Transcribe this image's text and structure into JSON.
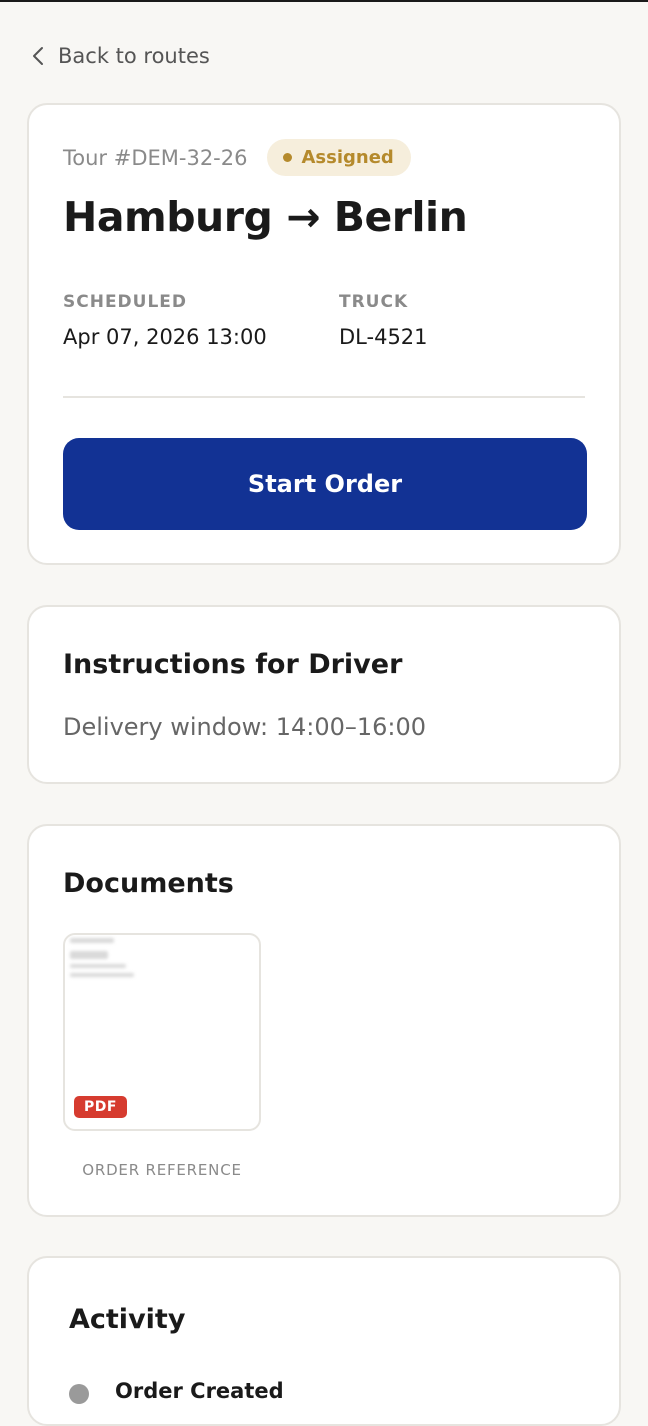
{
  "nav": {
    "back_label": "Back to routes",
    "back_icon": "chevron-left-icon"
  },
  "tour": {
    "id_label": "Tour #DEM-32-26",
    "status": "Assigned",
    "route": "Hamburg → Berlin",
    "scheduled_label": "SCHEDULED",
    "scheduled_value": "Apr 07, 2026 13:00",
    "truck_label": "TRUCK",
    "truck_value": "DL-4521",
    "start_button_label": "Start Order"
  },
  "instructions": {
    "title": "Instructions for Driver",
    "text": "Delivery window: 14:00–16:00"
  },
  "documents": {
    "title": "Documents",
    "items": [
      {
        "type_badge": "PDF",
        "caption": "ORDER REFERENCE"
      }
    ]
  },
  "activity": {
    "title": "Activity",
    "items": [
      {
        "label": "Order Created"
      }
    ]
  },
  "colors": {
    "background": "#f8f7f4",
    "card": "#ffffff",
    "primary": "#123294",
    "badge_bg": "#f6eedc",
    "badge_text": "#b58a2c",
    "pdf_badge": "#d63b2f",
    "muted_text": "#8a8a8a"
  }
}
